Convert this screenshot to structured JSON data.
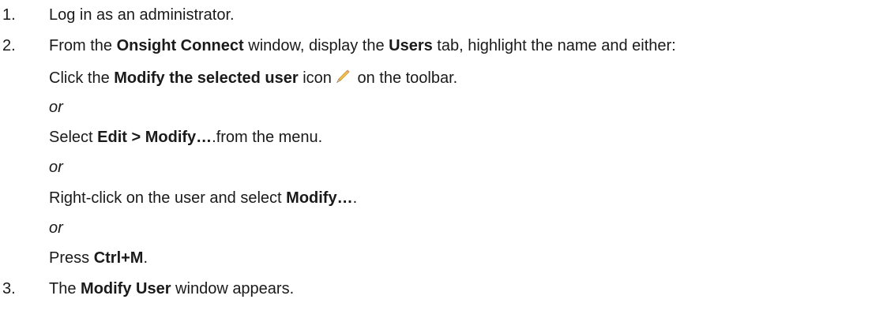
{
  "steps": [
    {
      "number": "1.",
      "text": "Log in as an administrator."
    },
    {
      "number": "2.",
      "intro": {
        "p1": "From the ",
        "b1": "Onsight Connect",
        "p2": " window, display the ",
        "b2": "Users",
        "p3": " tab, highlight the name and either:"
      },
      "options": {
        "opt1": {
          "p1": "Click the ",
          "b1": "Modify the selected user",
          "p2": " icon",
          "icon": "pencil-icon",
          "p3": " on the toolbar."
        },
        "or1": "or",
        "opt2": {
          "p1": "Select ",
          "b1": "Edit > Modify…",
          "p2": ".from the menu."
        },
        "or2": "or",
        "opt3": {
          "p1": "Right-click on the user and select ",
          "b1": "Modify…",
          "p2": "."
        },
        "or3": "or",
        "opt4": {
          "p1": "Press ",
          "b1": "Ctrl+M",
          "p2": "."
        }
      }
    },
    {
      "number": "3.",
      "p1": "The ",
      "b1": "Modify User",
      "p2": " window appears."
    }
  ],
  "colors": {
    "text": "#1a1a1a",
    "pencil_body": "#f2c14e",
    "pencil_tip": "#9a7b4f"
  }
}
